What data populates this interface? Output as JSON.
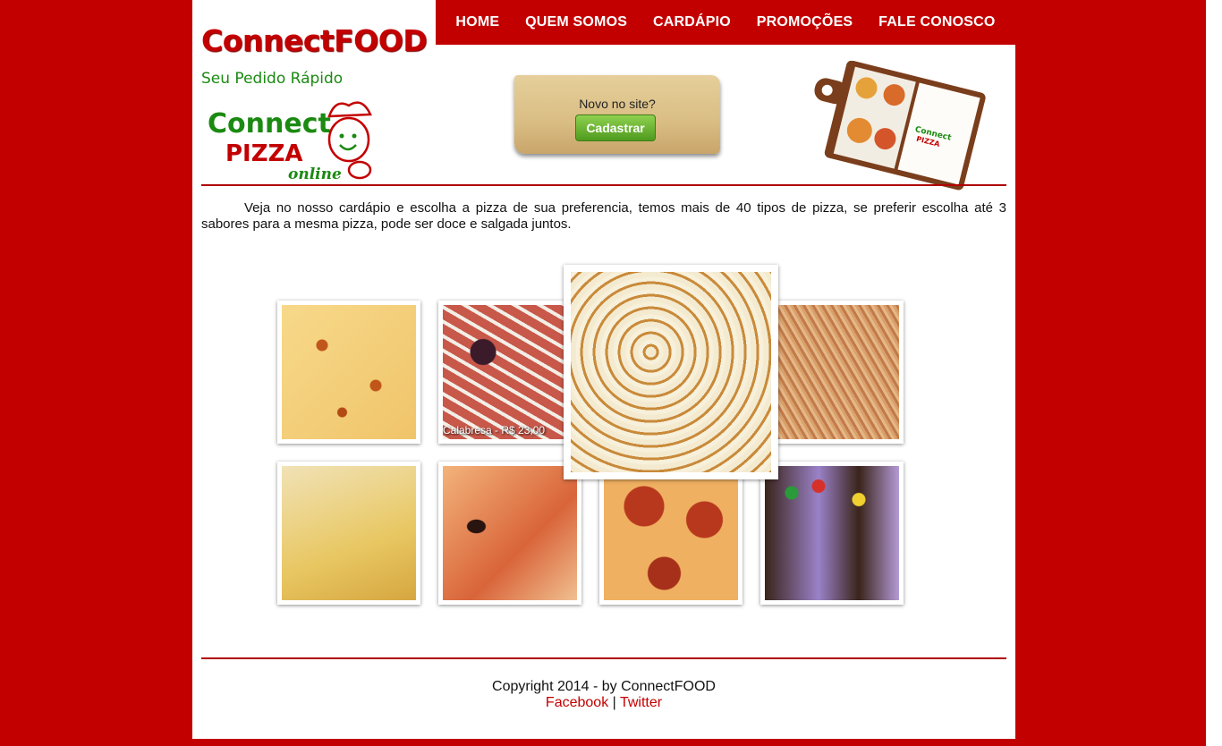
{
  "brand": {
    "title": "ConnectFOOD",
    "tagline": "Seu Pedido Rápido",
    "logo_text_1": "Connect",
    "logo_text_2": "PIZZA",
    "logo_text_3": "online"
  },
  "nav": {
    "items": [
      {
        "label": "HOME"
      },
      {
        "label": "QUEM SOMOS"
      },
      {
        "label": "CARDÁPIO"
      },
      {
        "label": "PROMOÇÕES"
      },
      {
        "label": "FALE CONOSCO"
      }
    ]
  },
  "signup": {
    "question": "Novo no site?",
    "button_label": "Cadastrar"
  },
  "intro_text": "Veja no nosso cardápio e escolha a pizza de sua preferencia, temos mais de 40 tipos de pizza, se preferir escolha até 3 sabores para a mesma pizza, pode ser doce e salgada juntos.",
  "gallery": {
    "calabresa_caption": "Calabresa - R$ 23,00"
  },
  "footer": {
    "copyright": "Copyright 2014 - by ConnectFOOD",
    "facebook": "Facebook",
    "separator": "|",
    "twitter": "Twitter"
  },
  "colors": {
    "brand_red": "#c30000",
    "brand_green": "#1b8a12"
  }
}
